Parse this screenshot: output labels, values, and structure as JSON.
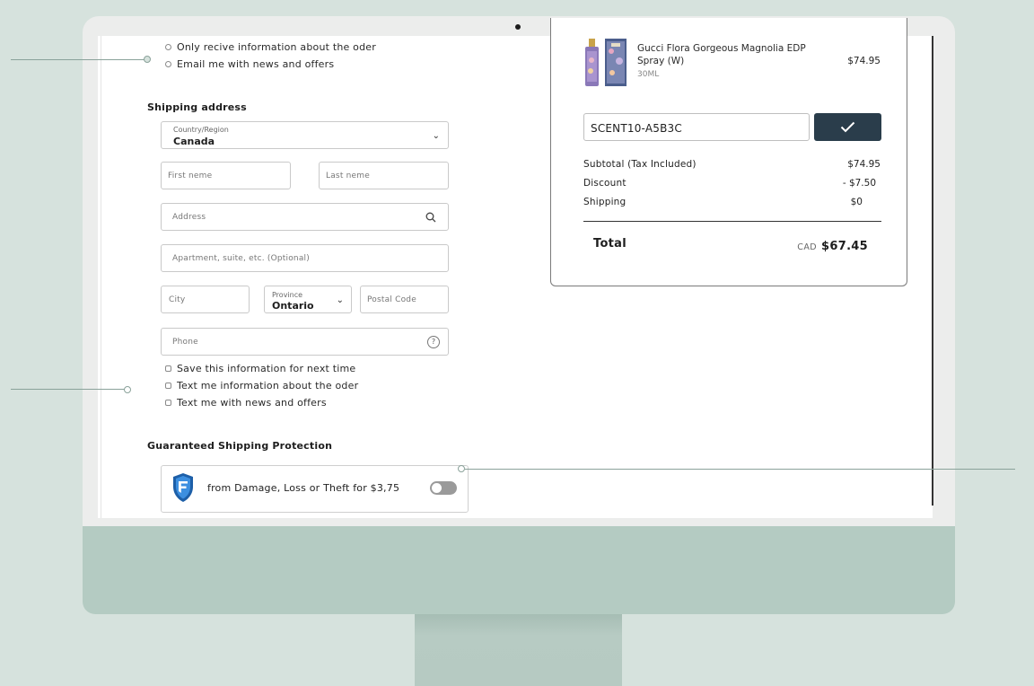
{
  "checkout": {
    "email_options": [
      {
        "label": "Only recive information about the oder",
        "checked": false
      },
      {
        "label": "Email me with news and offers",
        "checked": false
      }
    ],
    "shipping_title": "Shipping address",
    "country": {
      "label": "Country/Region",
      "value": "Canada"
    },
    "first_name": {
      "placeholder": "First neme"
    },
    "last_name": {
      "placeholder": "Last neme"
    },
    "address": {
      "placeholder": "Address"
    },
    "apartment": {
      "placeholder": "Apartment, suite, etc. (Optional)"
    },
    "city": {
      "placeholder": "City"
    },
    "province": {
      "label": "Province",
      "value": "Ontario"
    },
    "postal": {
      "placeholder": "Postal Code"
    },
    "phone": {
      "placeholder": "Phone",
      "help": "?"
    },
    "sms_options": [
      {
        "label": "Save this information for next time",
        "checked": false
      },
      {
        "label": "Text me information about the oder",
        "checked": false
      },
      {
        "label": "Text me with news and offers",
        "checked": false
      }
    ],
    "protection_title": "Guaranteed Shipping Protection",
    "protection_text": "from Damage, Loss or Theft for $3,75",
    "protection_enabled": false
  },
  "summary": {
    "product": {
      "name": "Gucci Flora Gorgeous Magnolia EDP Spray (W)",
      "variant": "30ML",
      "price": "$74.95"
    },
    "discount_code": "SCENT10-A5B3C",
    "apply_icon": "check-icon",
    "rows": [
      {
        "label": "Subtotal (Tax Included)",
        "value": "$74.95"
      },
      {
        "label": "Discount",
        "value": "- $7.50"
      },
      {
        "label": "Shipping",
        "value": "$0"
      }
    ],
    "total_label": "Total",
    "currency": "CAD",
    "total": "$67.45"
  },
  "colors": {
    "accent": "#2a3d4b",
    "background": "#d6e2dd",
    "monitor_chin": "#b4cbc2"
  }
}
